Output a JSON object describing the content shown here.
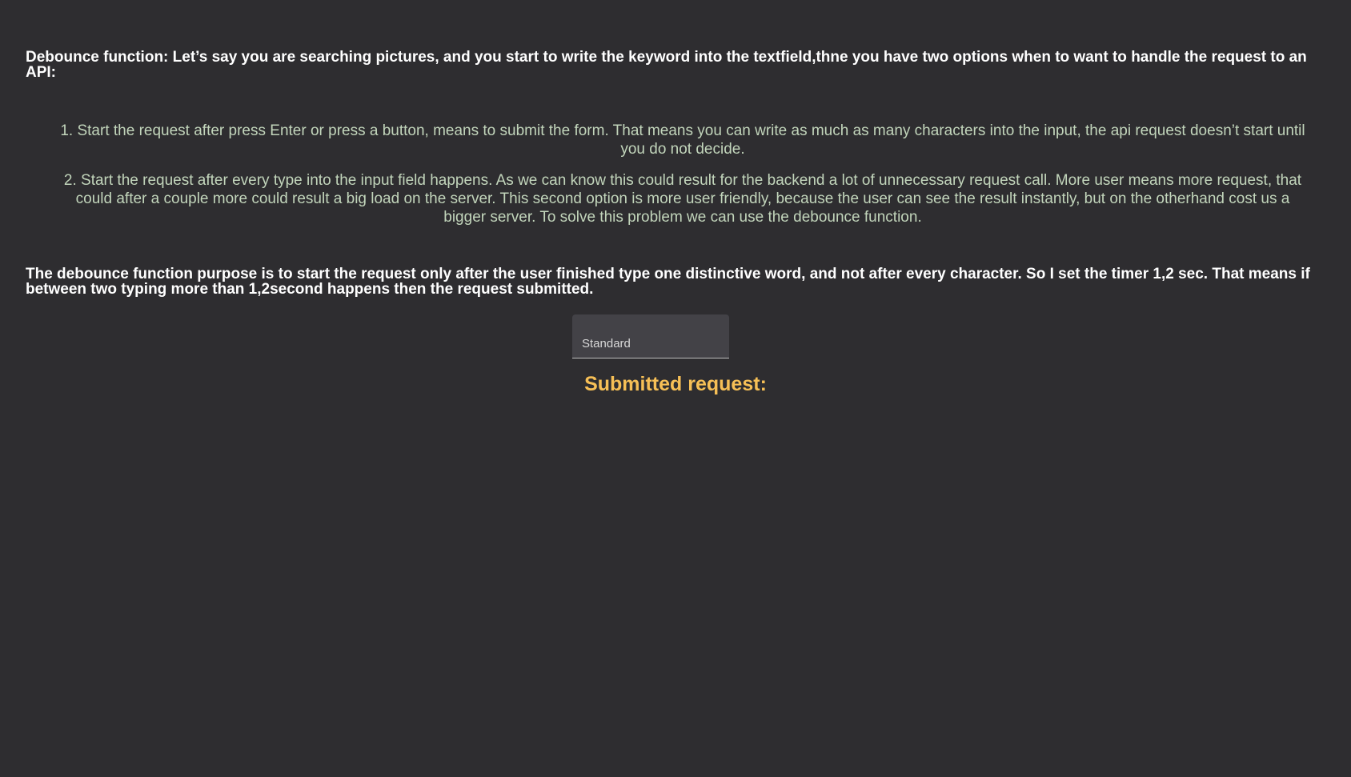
{
  "content": {
    "intro": "Debounce function: Let’s say you are searching pictures, and you start to write the keyword into the textfield,thne you have two options when to want to handle the request to an API:",
    "options": [
      "1. Start the request after press Enter or press a button, means to submit the form. That means you can write as much as many characters into the input, the api request doesn’t start until you do not decide.",
      "2. Start the request after every type into the input field happens. As we can know this could result for the backend a lot of unnecessary request call. More user means more request, that could after a couple more could result a big load on the server. This second option is more user friendly, because the user can see the result instantly, but on the otherhand cost us a bigger server. To solve this problem we can use the debounce function."
    ],
    "purpose": "The debounce function purpose is to start the request only after the user finished type one distinctive word, and not after every character. So I set the timer 1,2 sec. That means if between two typing more than 1,2second happens then the request submitted."
  },
  "search": {
    "placeholder": "Standard",
    "value": ""
  },
  "result": {
    "label": "Submitted request:"
  },
  "colors": {
    "background": "#2e2d30",
    "heading_text": "#ffffff",
    "list_text": "#c2d5bb",
    "accent": "#f6bf56"
  }
}
